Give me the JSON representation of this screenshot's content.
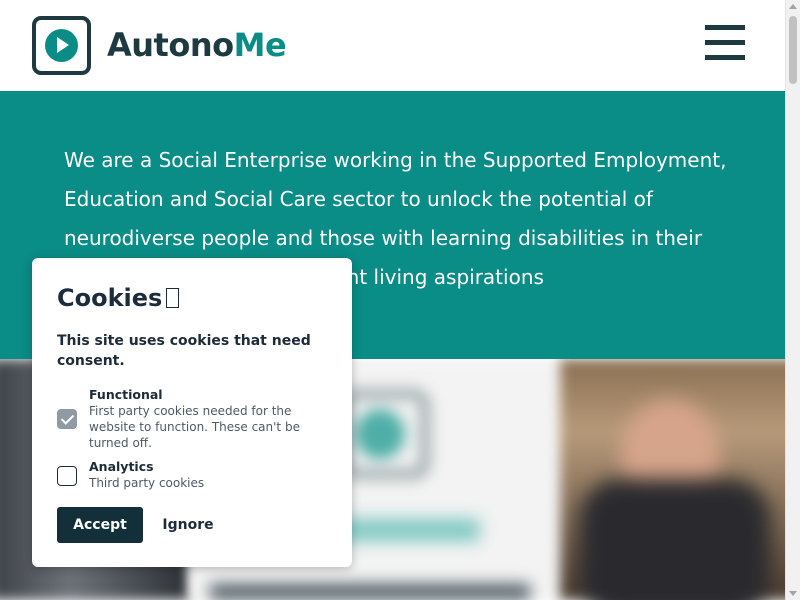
{
  "header": {
    "logo_text_part1": "Autono",
    "logo_text_part2": "Me",
    "logo_icon": "play-icon",
    "menu_icon": "hamburger-menu-icon"
  },
  "hero": {
    "text": "We are a Social Enterprise working in the Supported Employment, Education and Social Care sector to unlock the potential of neurodiverse people and those with learning disabilities in their employment and independent living aspirations"
  },
  "cookie_dialog": {
    "title": "Cookies",
    "title_icon": "cookie-emoji-icon",
    "description": "This site uses cookies that need consent.",
    "options": [
      {
        "label": "Functional",
        "description": "First party cookies needed for the website to function. These can't be turned off.",
        "checked": true,
        "disabled": true
      },
      {
        "label": "Analytics",
        "description": "Third party cookies",
        "checked": false,
        "disabled": false
      }
    ],
    "accept_label": "Accept",
    "ignore_label": "Ignore"
  },
  "colors": {
    "brand_teal": "#0a8c87",
    "brand_dark": "#1d3a40",
    "button_dark": "#13303a",
    "white": "#ffffff"
  }
}
